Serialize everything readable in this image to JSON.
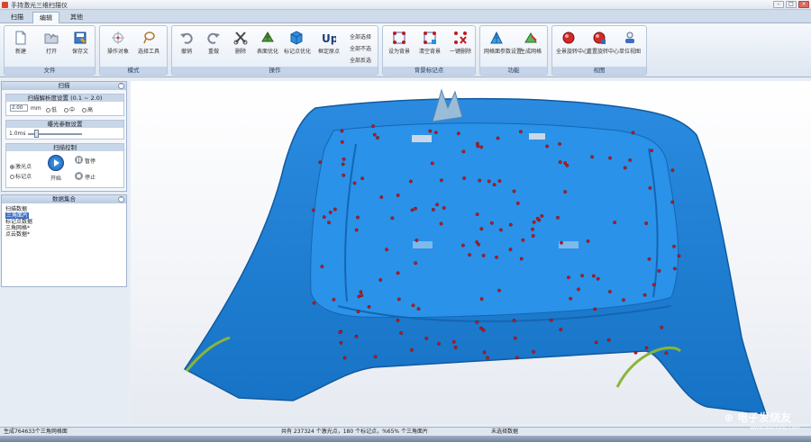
{
  "window": {
    "title": "手持激光三维扫描仪"
  },
  "tabs": [
    {
      "label": "扫描"
    },
    {
      "label": "编辑"
    },
    {
      "label": "其他"
    }
  ],
  "ribbon": {
    "groups": [
      {
        "label": "文件",
        "buttons": [
          {
            "label": "新建"
          },
          {
            "label": "打开"
          },
          {
            "label": "保存文"
          }
        ]
      },
      {
        "label": "模式",
        "buttons": [
          {
            "label": "操作对象"
          },
          {
            "label": "选择工具"
          }
        ]
      },
      {
        "label": "操作",
        "buttons": [
          {
            "label": "撤销"
          },
          {
            "label": "重做"
          },
          {
            "label": "删除"
          },
          {
            "label": "表面优化"
          },
          {
            "label": "标记点优化"
          },
          {
            "label": "框定原点"
          }
        ],
        "options": [
          {
            "label": "全部选择"
          },
          {
            "label": "全部不选"
          },
          {
            "label": "全部反选"
          }
        ]
      },
      {
        "label": "背景标记点",
        "buttons": [
          {
            "label": "设为背景"
          },
          {
            "label": "清空背景"
          },
          {
            "label": "一键删除"
          }
        ]
      },
      {
        "label": "功能",
        "buttons": [
          {
            "label": "网格面参数设置"
          },
          {
            "label": "生成网格"
          }
        ]
      },
      {
        "label": "视图",
        "buttons": [
          {
            "label": "全景旋转中心"
          },
          {
            "label": "重置旋转中心"
          },
          {
            "label": "单位视图"
          }
        ]
      }
    ]
  },
  "scan_panel": {
    "title": "扫描",
    "resolution": {
      "title": "扫描解析度设置 (0.1 ~ 2.0)",
      "value": "2.00",
      "unit": "mm",
      "options": [
        "低",
        "中",
        "高"
      ]
    },
    "exposure": {
      "title": "曝光参数设置",
      "value": "1.0ms",
      "level": 0.15
    },
    "control": {
      "title": "扫描控制",
      "modes": [
        "激光点",
        "标记点"
      ],
      "start_label": "开始",
      "pause_label": "暂停",
      "stop_label": "停止"
    }
  },
  "data_panel": {
    "title": "数据集合",
    "items": [
      "扫描数据",
      "三角面片",
      "标记点数据",
      "三角网格*",
      "点云数据*"
    ]
  },
  "status": {
    "left": "生成764633个三角网格面",
    "middle": "共有 237324 个激光点，180 个标记点，%65% 个三角面片",
    "right": "未选择数据"
  },
  "watermark": {
    "text": "电子发烧友",
    "url": "www.elecfans.com"
  },
  "colors": {
    "scan_blue": "#1e7fd6",
    "marker_red": "#c0191f",
    "ribbon_bg": "#dde6f1"
  }
}
